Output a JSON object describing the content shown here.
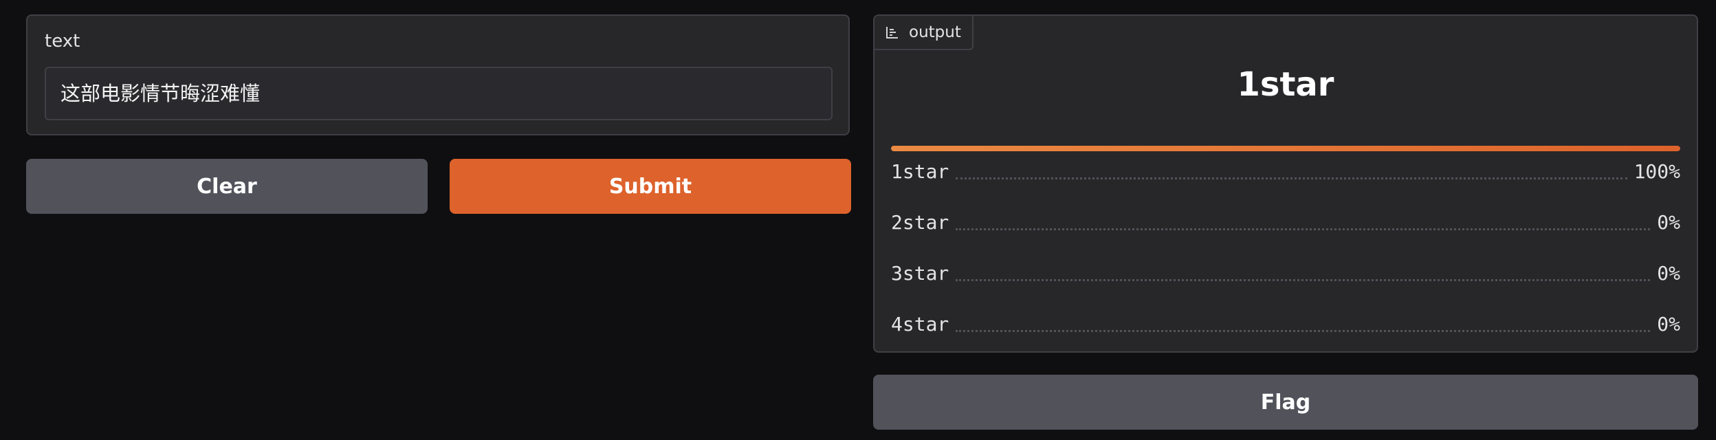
{
  "input": {
    "label": "text",
    "value": "这部电影情节晦涩难懂"
  },
  "buttons": {
    "clear": "Clear",
    "submit": "Submit",
    "flag": "Flag"
  },
  "output": {
    "tab_label": "output",
    "tab_icon": "bar-chart-icon",
    "top_label": "1star",
    "top_confidence": 1.0,
    "confidences": [
      {
        "label": "1star",
        "value": "100%"
      },
      {
        "label": "2star",
        "value": "0%"
      },
      {
        "label": "3star",
        "value": "0%"
      },
      {
        "label": "4star",
        "value": "0%"
      }
    ]
  },
  "colors": {
    "background": "#0f0f11",
    "panel": "#27272a",
    "primary": "#dd622b",
    "secondary": "#52525b"
  }
}
